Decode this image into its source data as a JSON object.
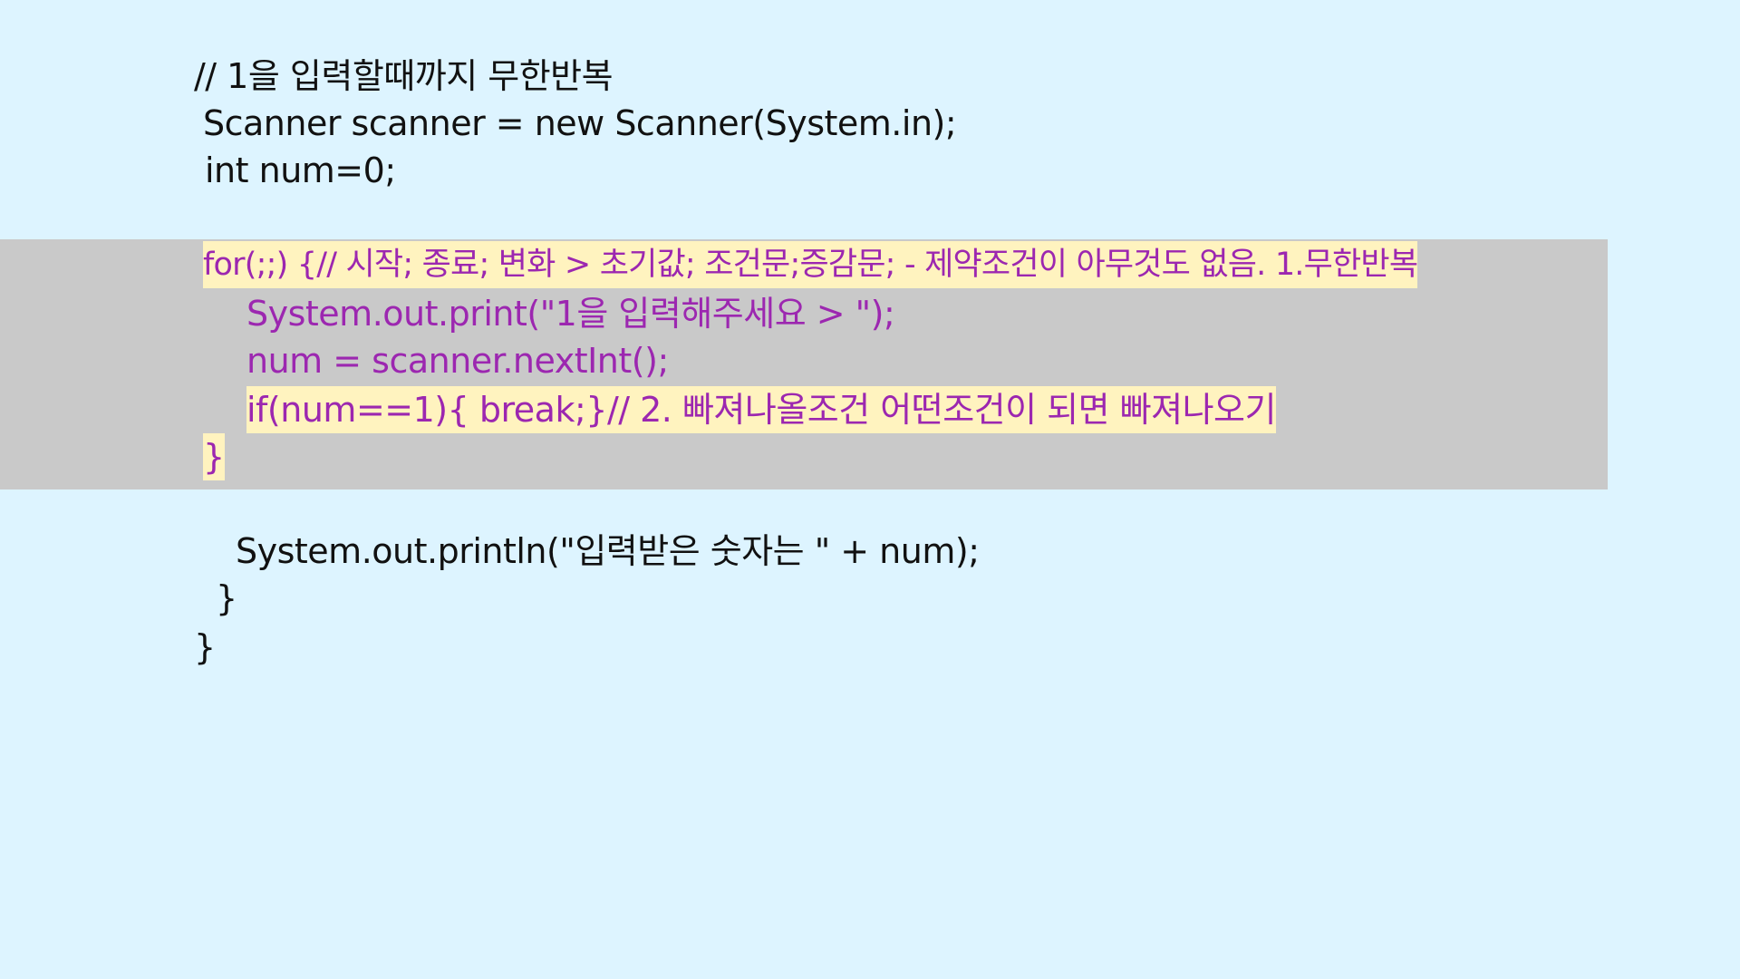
{
  "code": {
    "comment_line": "// 1을 입력할때까지 무한반복",
    "scanner_line": "Scanner scanner = new Scanner(System.in);",
    "num_line": "int num=0;",
    "loop": {
      "for_line": "for(;;) {// 시작; 종료; 변화 > 초기값; 조건문;증감문; - 제약조건이 아무것도 없음. 1.무한반복",
      "print_line": "System.out.print(\"1을 입력해주세요 > \");",
      "read_line": "num = scanner.nextInt();",
      "if_line": "if(num==1){ break;}// 2. 빠져나올조건 어떤조건이 되면 빠져나오기",
      "close_brace": "}"
    },
    "println_line": "System.out.println(\"입력받은 숫자는 \" + num);",
    "method_close": "}",
    "class_close": "}"
  },
  "colors": {
    "background": "#ddf4ff",
    "loop_block": "#c9c9c9",
    "highlight": "#fff3bf",
    "loop_text": "#9c27b0",
    "text": "#111111"
  }
}
